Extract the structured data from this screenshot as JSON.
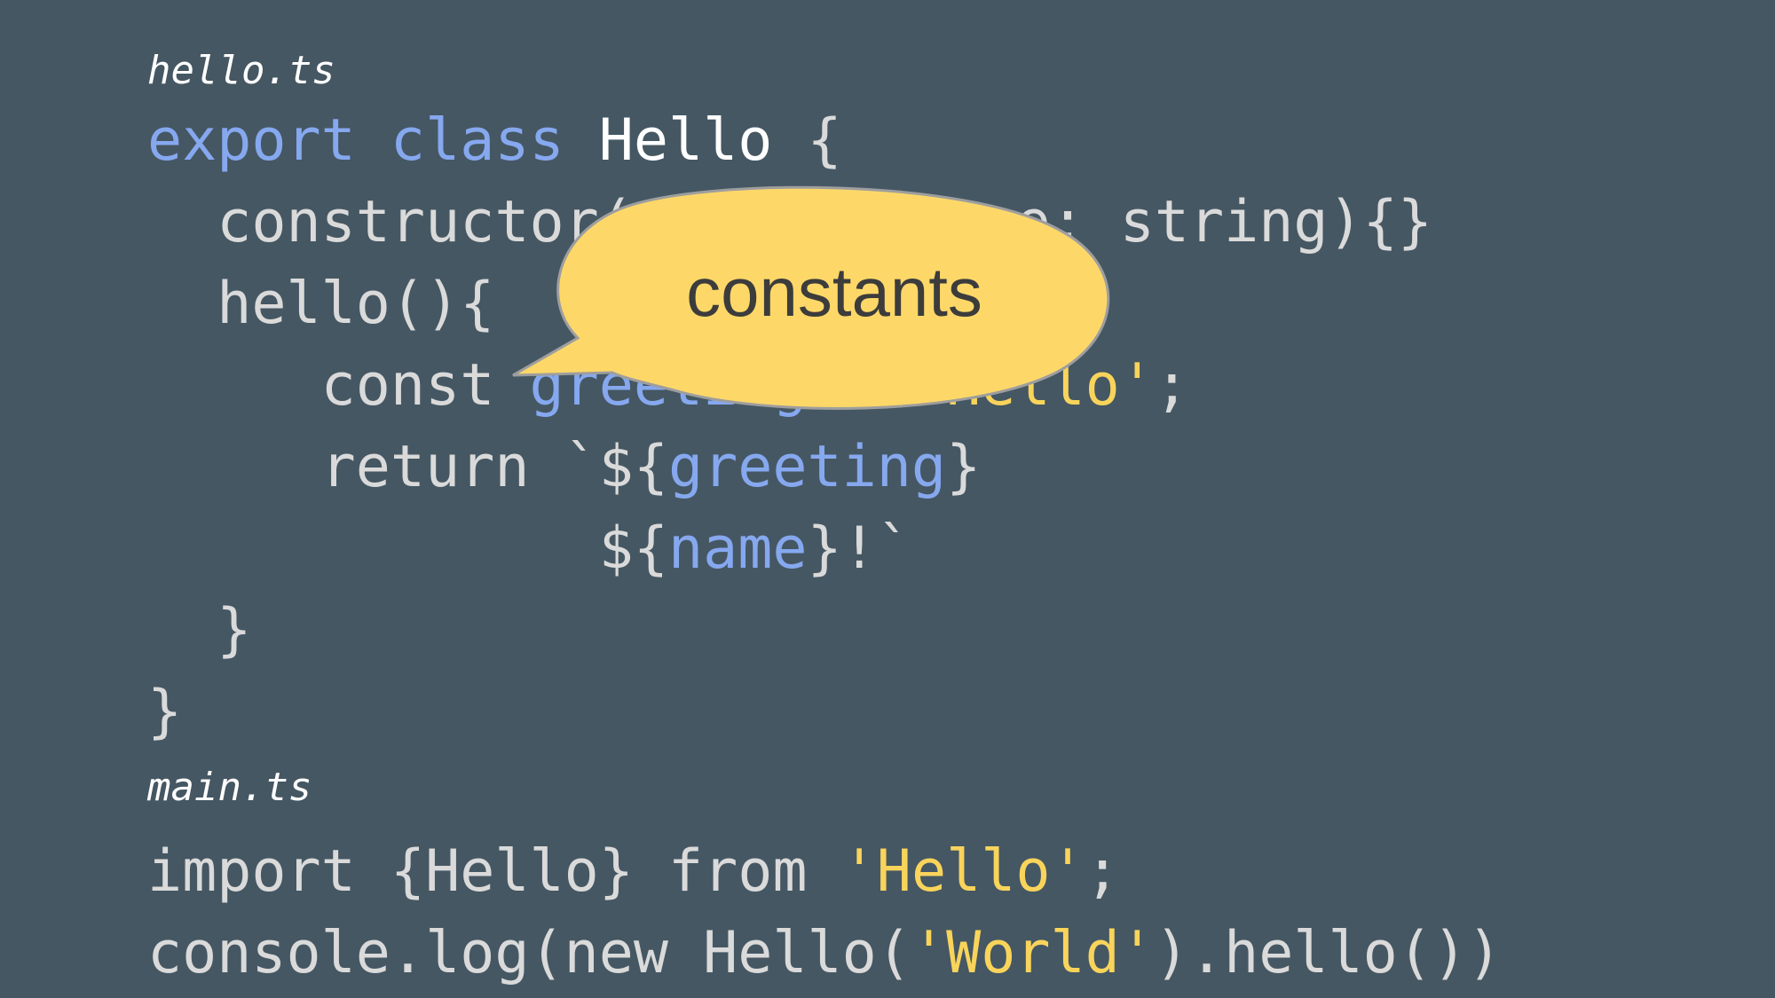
{
  "files": [
    {
      "name": "hello.ts",
      "lines": [
        [
          {
            "t": "export class ",
            "c": "kw"
          },
          {
            "t": "Hello",
            "c": "ty"
          },
          {
            "t": " {",
            "c": "txt"
          }
        ],
        [
          {
            "t": "  constructor(private name: string){}",
            "c": "txt"
          }
        ],
        [
          {
            "t": "  hello(){",
            "c": "txt"
          }
        ],
        [
          {
            "t": "     const ",
            "c": "txt"
          },
          {
            "t": "greeting",
            "c": "kw"
          },
          {
            "t": " = ",
            "c": "txt"
          },
          {
            "t": "'Hello'",
            "c": "str"
          },
          {
            "t": ";",
            "c": "txt"
          }
        ],
        [
          {
            "t": "     return `${",
            "c": "txt"
          },
          {
            "t": "greeting",
            "c": "kw"
          },
          {
            "t": "}",
            "c": "txt"
          }
        ],
        [
          {
            "t": "             ${",
            "c": "txt"
          },
          {
            "t": "name",
            "c": "kw"
          },
          {
            "t": "}!`",
            "c": "txt"
          }
        ],
        [
          {
            "t": "  }",
            "c": "txt"
          }
        ],
        [
          {
            "t": "}",
            "c": "txt"
          }
        ]
      ]
    },
    {
      "name": "main.ts",
      "lines": [
        [
          {
            "t": "import {Hello} from ",
            "c": "txt"
          },
          {
            "t": "'Hello'",
            "c": "str"
          },
          {
            "t": ";",
            "c": "txt"
          }
        ],
        [
          {
            "t": "console.log(new Hello(",
            "c": "txt"
          },
          {
            "t": "'World'",
            "c": "str"
          },
          {
            "t": ").hello())",
            "c": "txt"
          }
        ]
      ]
    }
  ],
  "callout": {
    "text": "constants",
    "fill": "#fdd868",
    "stroke": "#9e9e9e"
  },
  "colors": {
    "background": "#455763",
    "keyword": "#86a8ef",
    "type": "#ffffff",
    "string": "#f9d45b",
    "text": "#dadada"
  }
}
